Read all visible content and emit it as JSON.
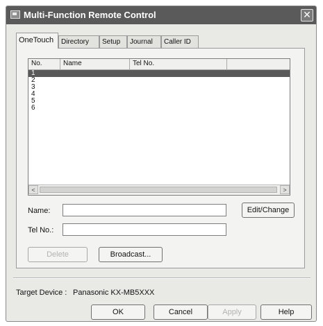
{
  "window": {
    "title": "Multi-Function Remote Control",
    "close_glyph": "✕"
  },
  "tabs": [
    {
      "label": "OneTouch",
      "active": true
    },
    {
      "label": "Directory",
      "active": false
    },
    {
      "label": "Setup",
      "active": false
    },
    {
      "label": "Journal",
      "active": false
    },
    {
      "label": "Caller ID",
      "active": false
    }
  ],
  "list": {
    "columns": [
      "No.",
      "Name",
      "Tel No."
    ],
    "rows": [
      {
        "no": "1",
        "name": "",
        "tel": "",
        "selected": true
      },
      {
        "no": "2",
        "name": "",
        "tel": "",
        "selected": false
      },
      {
        "no": "3",
        "name": "",
        "tel": "",
        "selected": false
      },
      {
        "no": "4",
        "name": "",
        "tel": "",
        "selected": false
      },
      {
        "no": "5",
        "name": "",
        "tel": "",
        "selected": false
      },
      {
        "no": "6",
        "name": "",
        "tel": "",
        "selected": false
      }
    ],
    "scroll_left": "<",
    "scroll_right": ">"
  },
  "form": {
    "name_label": "Name:",
    "name_value": "",
    "tel_label": "Tel No.:",
    "tel_value": "",
    "edit_button": "Edit/Change",
    "delete_button": "Delete",
    "broadcast_button": "Broadcast..."
  },
  "target": {
    "label": "Target Device :",
    "value": "Panasonic KX-MB5XXX"
  },
  "footer": {
    "ok": "OK",
    "cancel": "Cancel",
    "apply": "Apply",
    "help": "Help"
  },
  "colors": {
    "titlebar": "#5a5a5a",
    "selection": "#595959",
    "dialog_bg": "#e9e9e6"
  }
}
